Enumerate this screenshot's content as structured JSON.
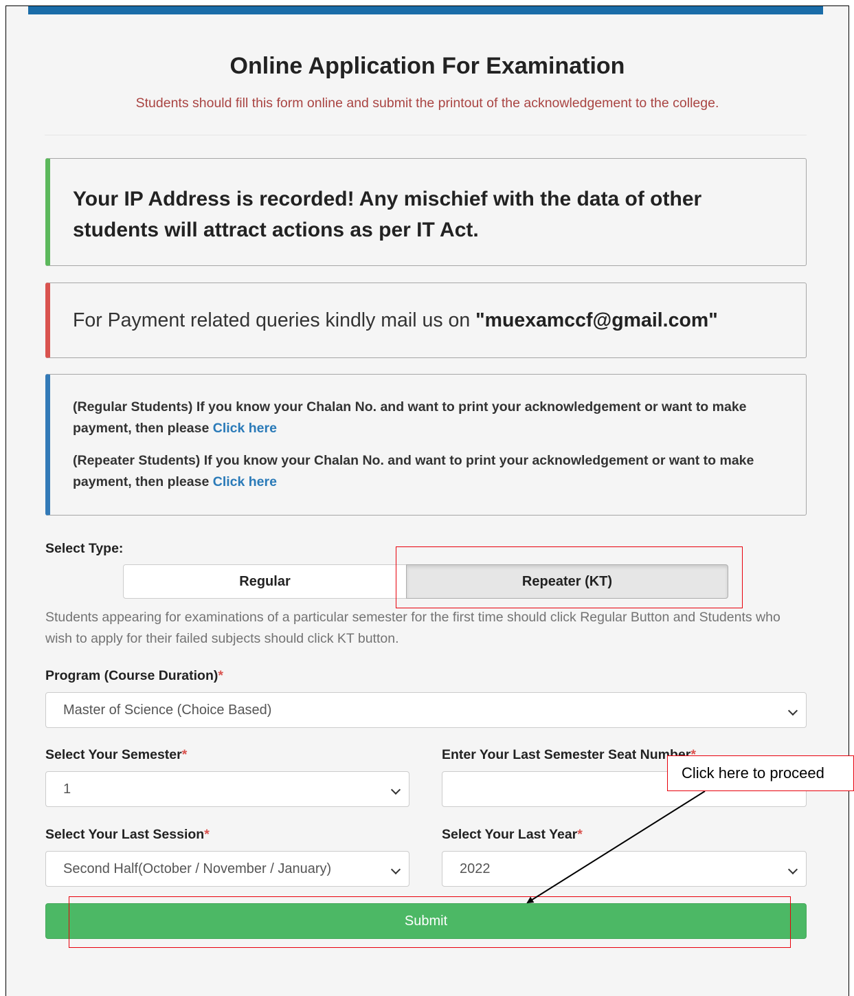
{
  "header": {
    "title": "Online Application For Examination",
    "subtitle": "Students should fill this form online and submit the printout of the acknowledgement to the college."
  },
  "alerts": {
    "warning": "Your IP Address is recorded! Any mischief with the data of other students will attract actions as per IT Act.",
    "payment_prefix": "For Payment related queries kindly mail us on ",
    "payment_email": "\"muexamccf@gmail.com\"",
    "regular_text": "(Regular Students) If you know your Chalan No. and want to print your acknowledgement or want to make payment, then please ",
    "repeater_text": "(Repeater Students) If you know your Chalan No. and want to print your acknowledgement or want to make payment, then please ",
    "link_label": "Click here"
  },
  "type_select": {
    "label": "Select Type:",
    "regular": "Regular",
    "repeater": "Repeater (KT)",
    "selected": "Repeater (KT)",
    "help": "Students appearing for examinations of a particular semester for the first time should click Regular Button and Students who wish to apply for their failed subjects should click KT button."
  },
  "form": {
    "required_mark": "*",
    "program_label": "Program (Course Duration)",
    "program_value": "Master of Science (Choice Based)",
    "semester_label": "Select Your Semester",
    "semester_value": "1",
    "seat_label": "Enter Your Last Semester Seat Number",
    "seat_value": "",
    "session_label": "Select Your Last Session",
    "session_value": "Second Half(October / November / January)",
    "year_label": "Select Your Last Year",
    "year_value": "2022",
    "submit_label": "Submit"
  },
  "annotation": {
    "callout": "Click here to proceed",
    "color": "#e8000b"
  },
  "colors": {
    "topbar": "#1a6ca8",
    "submit": "#4cb865",
    "alert_green": "#5cb85c",
    "alert_red": "#d9534f",
    "alert_blue": "#337ab7",
    "link": "#2a7ab8",
    "subtitle": "#a94442"
  }
}
